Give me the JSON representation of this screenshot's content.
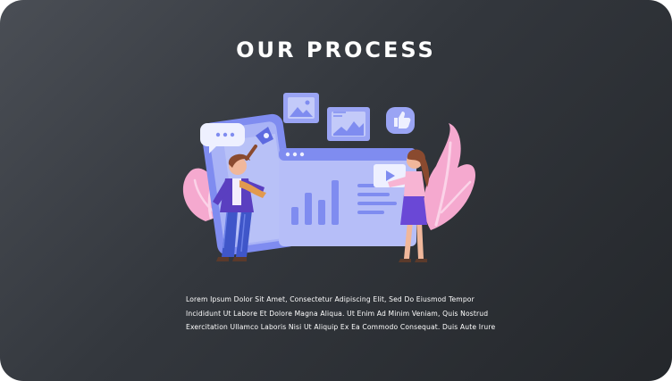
{
  "section": {
    "title": "OUR PROCESS",
    "description_lines": [
      "Lorem Ipsum Dolor Sit Amet, Consectetur Adipiscing Elit, Sed Do Eiusmod Tempor",
      "Incididunt Ut Labore Et Dolore Magna Aliqua. Ut Enim Ad Minim Veniam, Quis Nostrud",
      "Exercitation Ullamco Laboris Nisi Ut Aliquip Ex Ea Commodo Consequat. Duis Aute Irure"
    ]
  },
  "colors": {
    "background_start": "#4a4e55",
    "background_end": "#24272b",
    "title_text": "#ffffff",
    "illustration_primary": "#7f8cf0",
    "illustration_light": "#b6bef8",
    "illustration_pink": "#f7a8d0"
  },
  "icons": [
    "chat-bubble-icon",
    "image-icon",
    "line-chart-icon",
    "thumbs-up-icon",
    "play-icon",
    "rocket-icon"
  ]
}
